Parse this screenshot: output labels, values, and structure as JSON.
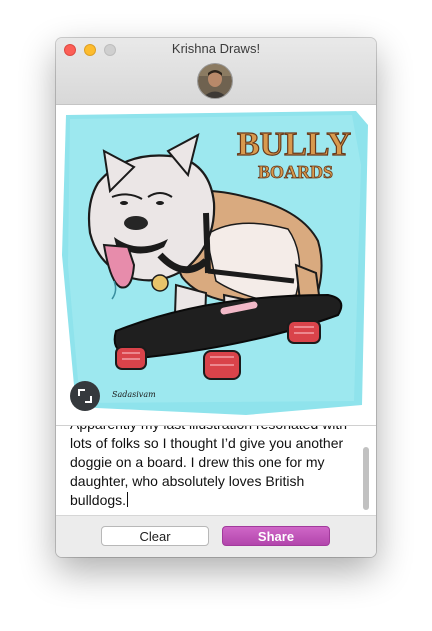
{
  "window": {
    "title": "Krishna Draws!"
  },
  "illustration": {
    "logo_line1": "BULLY",
    "logo_line2": "BOARDS",
    "signature": "Sadasivam"
  },
  "caption": {
    "text": "Apparently my last illustration resonated with lots of folks so I thought I’d give you another doggie on a board. I drew this one for my daughter, who absolutely loves British bulldogs."
  },
  "buttons": {
    "clear_label": "Clear",
    "share_label": "Share"
  },
  "colors": {
    "share_accent": "#bd4fb7",
    "background_splash": "#8fe3ec"
  },
  "icons": {
    "expand": "expand-icon"
  }
}
